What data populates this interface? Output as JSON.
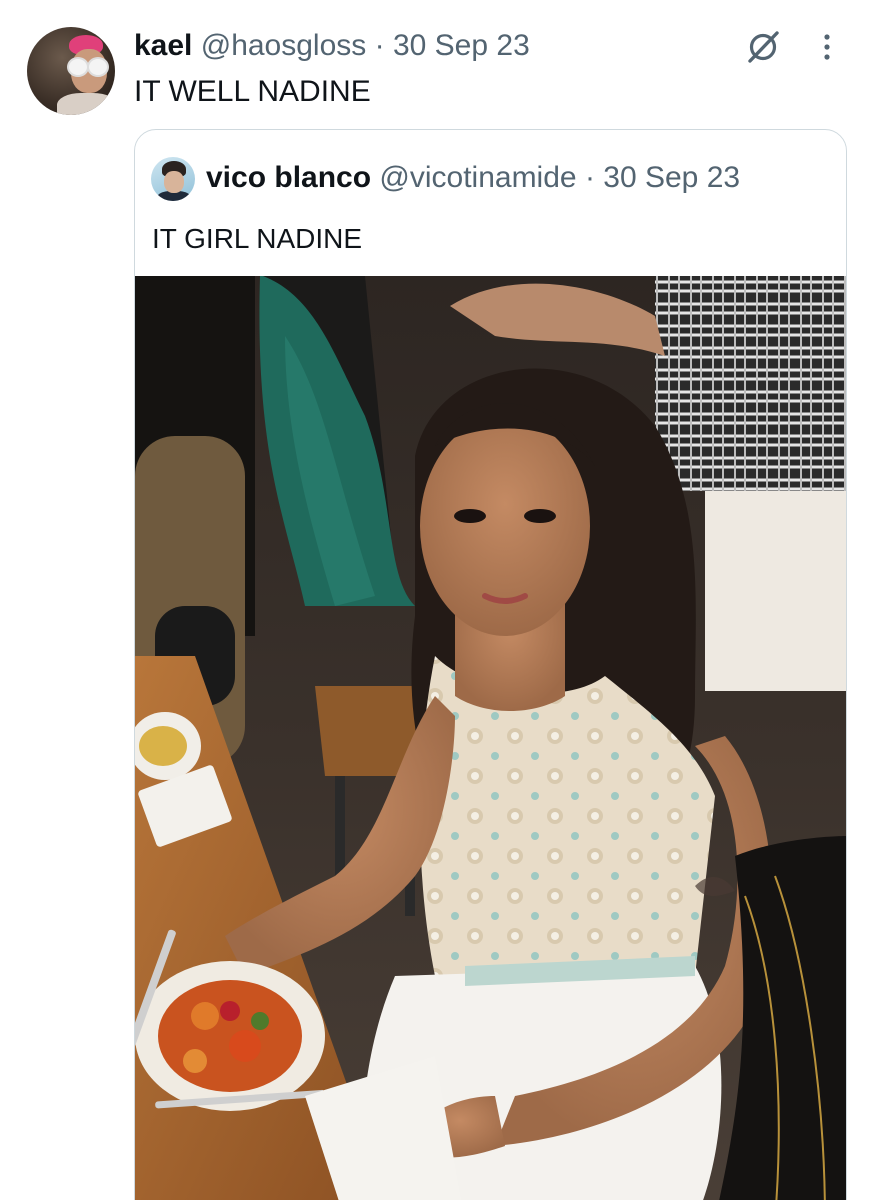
{
  "tweet": {
    "author_name": "kael",
    "author_handle": "@haosgloss",
    "separator": "·",
    "date": "30 Sep 23",
    "text": "IT WELL NADINE",
    "avatar_icon": "user-avatar",
    "grok_icon": "grok-icon",
    "more_icon": "more-options-icon"
  },
  "quoted_tweet": {
    "author_name": "vico blanco",
    "author_handle": "@vicotinamide",
    "separator": "·",
    "date": "30 Sep 23",
    "text": "IT GIRL NADINE",
    "avatar_icon": "user-avatar",
    "media": "photo"
  },
  "colors": {
    "text_primary": "#0f1419",
    "text_secondary": "#536471",
    "border": "#cfd9de",
    "background": "#ffffff"
  }
}
